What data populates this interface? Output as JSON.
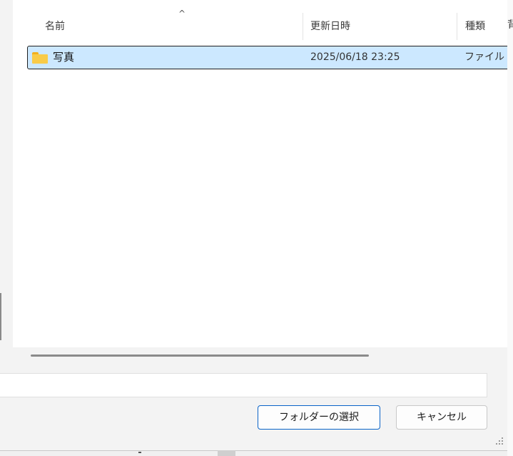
{
  "columns": {
    "name": "名前",
    "date": "更新日時",
    "type": "種類"
  },
  "sort": {
    "column": "name",
    "direction": "ascending",
    "icon": "sort-ascending-icon"
  },
  "files": [
    {
      "name": "写真",
      "date": "2025/06/18 23:25",
      "type": "ファイル フ",
      "icon": "folder-icon",
      "selected": true
    }
  ],
  "folder_input": {
    "value": ""
  },
  "buttons": {
    "select_folder": "フォルダーの選択",
    "cancel": "キャンセル"
  },
  "background": {
    "right_edge_char": "背"
  },
  "colors": {
    "selection": "#cce8ff",
    "primary_border": "#0a64c8",
    "folder": "#f9cb48"
  }
}
